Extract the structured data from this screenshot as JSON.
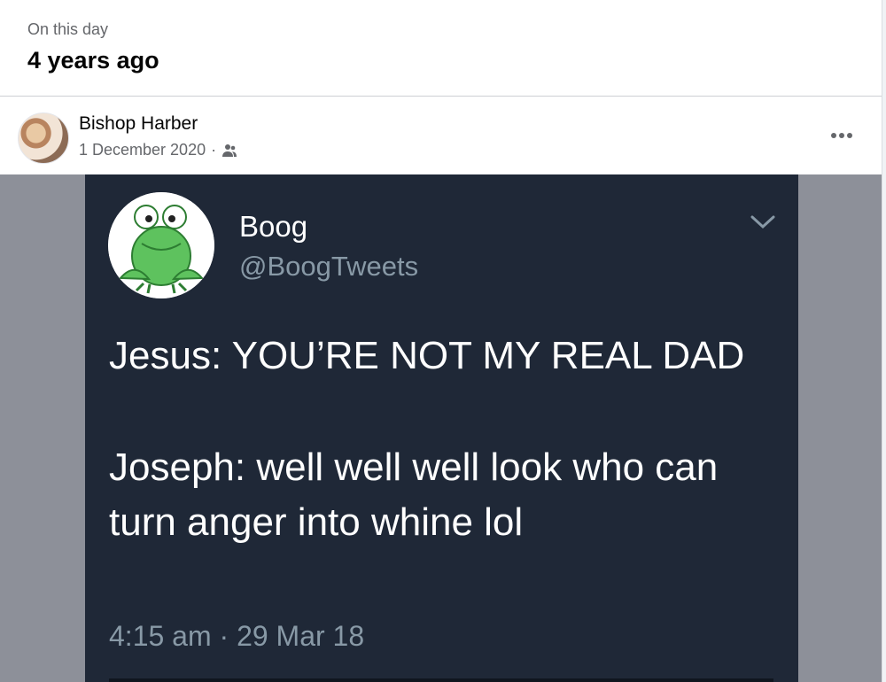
{
  "memory": {
    "kicker": "On this day",
    "title": "4 years ago"
  },
  "post": {
    "author": "Bishop Harber",
    "date": "1 December 2020",
    "separator": "·",
    "audience_icon": "friends-icon",
    "more_icon": "more-options-icon"
  },
  "tweet": {
    "name": "Boog",
    "handle": "@BoogTweets",
    "lines": [
      "Jesus: YOU’RE NOT MY REAL DAD",
      "Joseph: well well well look who can turn anger into whine lol"
    ],
    "time": "4:15 am · 29 Mar 18",
    "avatar_icon": "frog-avatar-icon",
    "menu_icon": "chevron-down-icon"
  },
  "colors": {
    "tweet_bg": "#1f2837",
    "secondary_text": "#65676b",
    "frog_green": "#5ec25e"
  }
}
